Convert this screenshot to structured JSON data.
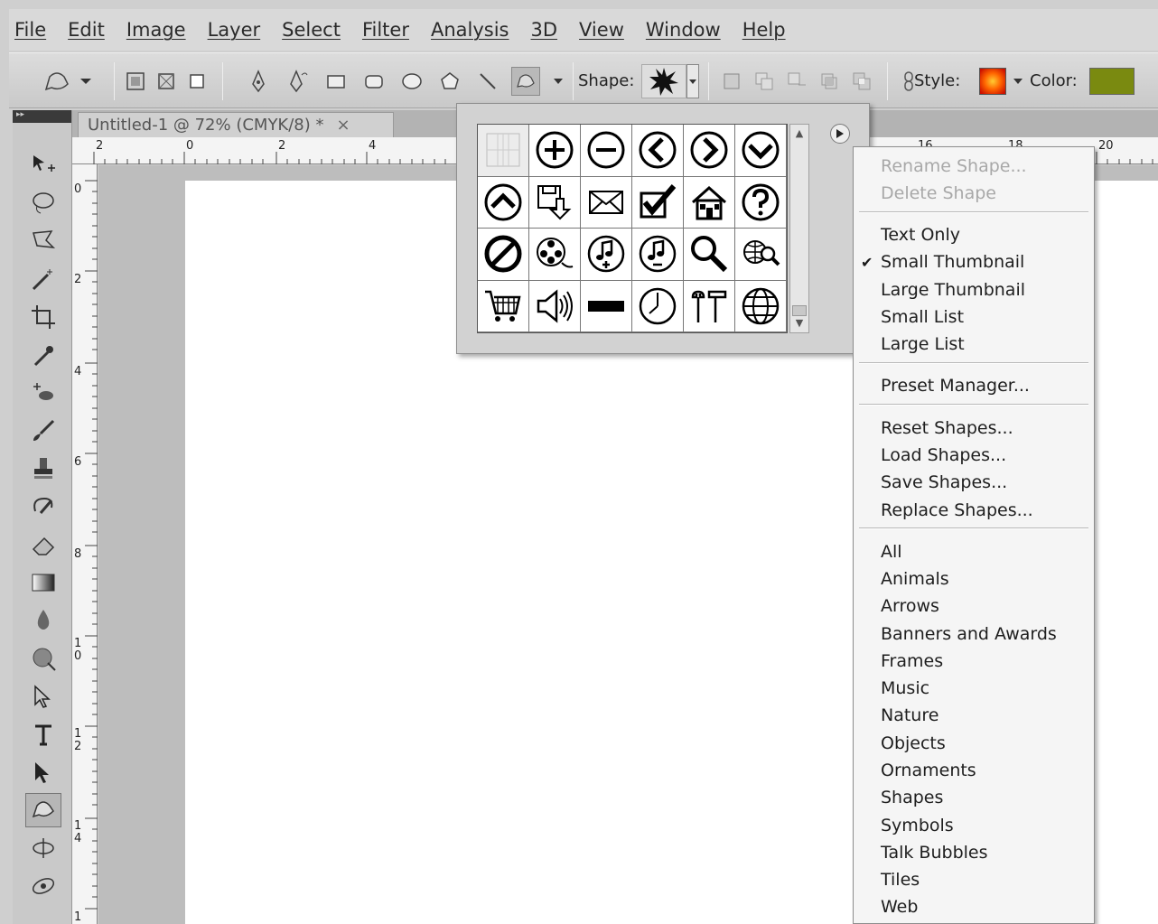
{
  "menubar": {
    "items": [
      "File",
      "Edit",
      "Image",
      "Layer",
      "Select",
      "Filter",
      "Analysis",
      "3D",
      "View",
      "Window",
      "Help"
    ]
  },
  "options": {
    "shape_label": "Shape:",
    "style_label": "Style:",
    "color_label": "Color:",
    "color_value": "#7a8a10"
  },
  "document": {
    "tab_title": "Untitled-1 @ 72% (CMYK/8) *",
    "close_glyph": "×"
  },
  "ruler": {
    "top_labels": [
      "2",
      "0",
      "2",
      "4",
      "16",
      "18",
      "20"
    ],
    "left_labels": [
      "0",
      "2",
      "4",
      "6",
      "8",
      "1 0",
      "1 2",
      "1 4",
      "1"
    ]
  },
  "shape_picker": {
    "shapes": [
      "grid-icon",
      "plus-circle-icon",
      "minus-circle-icon",
      "left-arrow-circle-icon",
      "right-arrow-circle-icon",
      "down-arrow-circle-icon",
      "up-arrow-circle-icon",
      "save-floppy-icon",
      "envelope-icon",
      "checkbox-icon",
      "house-icon",
      "question-icon",
      "prohibited-icon",
      "film-reel-icon",
      "music-plus-icon",
      "music-minus-icon",
      "magnifier-icon",
      "web-search-icon",
      "shopping-cart-icon",
      "speaker-icon",
      "minus-bar-icon",
      "clock-icon",
      "tools-icon",
      "globe-icon"
    ]
  },
  "context_menu": {
    "rename_shape": "Rename Shape...",
    "delete_shape": "Delete Shape",
    "view_options": [
      "Text Only",
      "Small Thumbnail",
      "Large Thumbnail",
      "Small List",
      "Large List"
    ],
    "checked_view": "Small Thumbnail",
    "preset_manager": "Preset Manager...",
    "file_actions": [
      "Reset Shapes...",
      "Load Shapes...",
      "Save Shapes...",
      "Replace Shapes..."
    ],
    "libraries": [
      "All",
      "Animals",
      "Arrows",
      "Banners and Awards",
      "Frames",
      "Music",
      "Nature",
      "Objects",
      "Ornaments",
      "Shapes",
      "Symbols",
      "Talk Bubbles",
      "Tiles",
      "Web"
    ]
  }
}
